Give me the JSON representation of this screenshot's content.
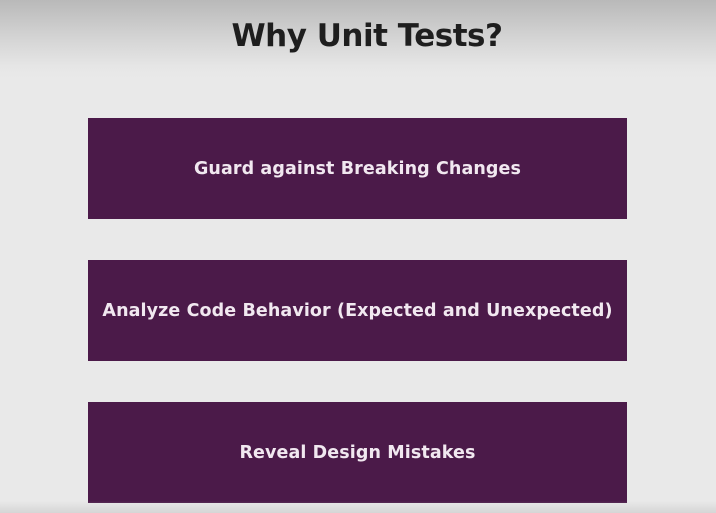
{
  "slide": {
    "title": "Why Unit Tests?",
    "items": [
      {
        "label": "Guard against Breaking Changes"
      },
      {
        "label": "Analyze Code Behavior (Expected and Unexpected)"
      },
      {
        "label": "Reveal Design Mistakes"
      }
    ]
  },
  "colors": {
    "background": "#e9e9e9",
    "card": "#4b1a49",
    "card_text": "#f1e8f0",
    "title_text": "#1e1e1e"
  }
}
